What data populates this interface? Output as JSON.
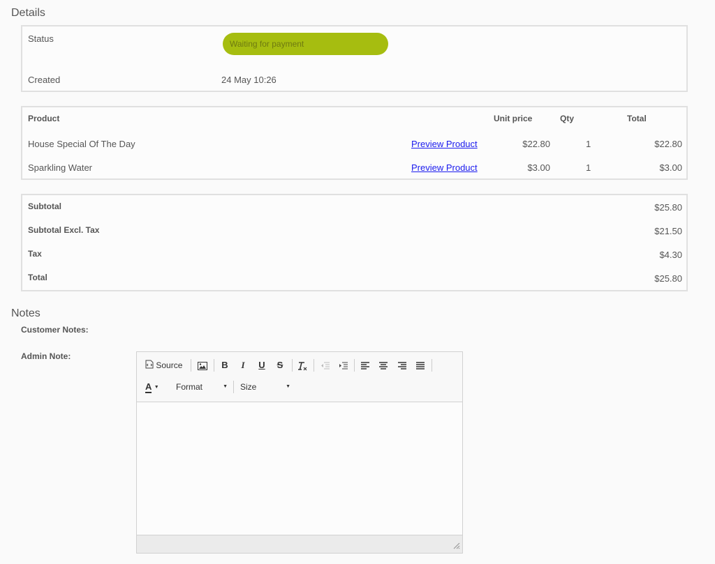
{
  "details": {
    "title": "Details",
    "status_label": "Status",
    "status_value": "Waiting for payment",
    "created_label": "Created",
    "created_value": "24 May 10:26"
  },
  "products": {
    "headers": {
      "product": "Product",
      "unit_price": "Unit price",
      "qty": "Qty",
      "total": "Total"
    },
    "rows": [
      {
        "name": "House Special Of The Day",
        "link": "Preview Product",
        "unit_price": "$22.80",
        "qty": "1",
        "total": "$22.80"
      },
      {
        "name": "Sparkling Water",
        "link": "Preview Product",
        "unit_price": "$3.00",
        "qty": "1",
        "total": "$3.00"
      }
    ]
  },
  "totals": [
    {
      "label": "Subtotal",
      "value": "$25.80"
    },
    {
      "label": "Subtotal Excl. Tax",
      "value": "$21.50"
    },
    {
      "label": "Tax",
      "value": "$4.30"
    },
    {
      "label": "Total",
      "value": "$25.80"
    }
  ],
  "notes": {
    "title": "Notes",
    "customer_label": "Customer Notes:",
    "admin_label": "Admin Note:"
  },
  "editor": {
    "source_label": "Source",
    "format_label": "Format",
    "size_label": "Size",
    "bold_glyph": "B",
    "italic_glyph": "I",
    "underline_glyph": "U",
    "strike_glyph": "S",
    "text_color_glyph": "A"
  },
  "colors": {
    "status_badge": "#a6bd10",
    "link": "#1a1aee"
  }
}
